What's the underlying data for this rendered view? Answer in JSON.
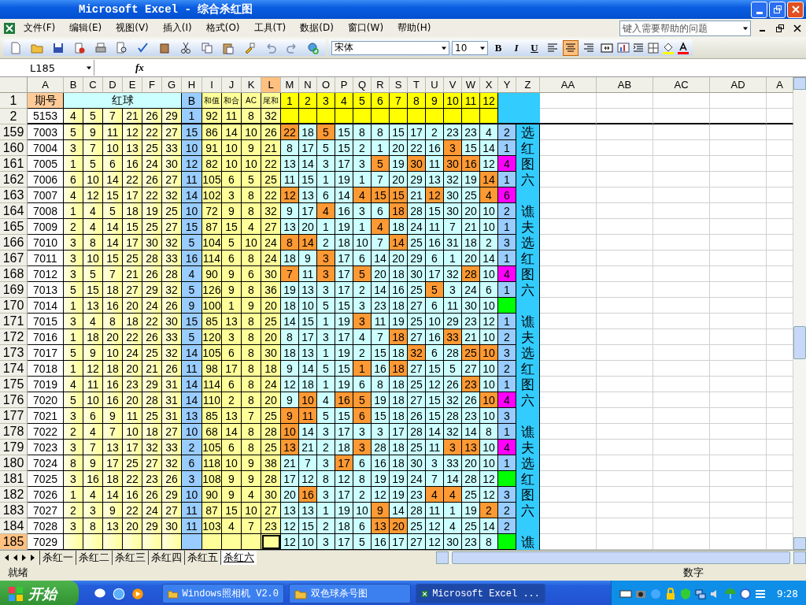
{
  "window": {
    "title": "Microsoft Excel - 综合杀红图"
  },
  "menu": [
    "文件(F)",
    "编辑(E)",
    "视图(V)",
    "插入(I)",
    "格式(O)",
    "工具(T)",
    "数据(D)",
    "窗口(W)",
    "帮助(H)"
  ],
  "help_box": {
    "placeholder": "键入需要帮助的问题"
  },
  "font_box": {
    "value": "宋体"
  },
  "size_box": {
    "value": "10"
  },
  "format_buttons": [
    "B",
    "I",
    "U"
  ],
  "align_buttons": [
    {
      "kind": "left",
      "selected": false
    },
    {
      "kind": "center",
      "selected": true
    },
    {
      "kind": "right",
      "selected": false
    },
    {
      "kind": "merge",
      "selected": false
    }
  ],
  "name_box": {
    "value": "L185"
  },
  "fx_label": "fx",
  "columns": [
    {
      "label": "A",
      "selected": false
    },
    {
      "label": "B",
      "selected": false
    },
    {
      "label": "C",
      "selected": false
    },
    {
      "label": "D",
      "selected": false
    },
    {
      "label": "E",
      "selected": false
    },
    {
      "label": "F",
      "selected": false
    },
    {
      "label": "G",
      "selected": false
    },
    {
      "label": "H",
      "selected": false
    },
    {
      "label": "I",
      "selected": false
    },
    {
      "label": "J",
      "selected": false
    },
    {
      "label": "K",
      "selected": false
    },
    {
      "label": "L",
      "selected": true
    },
    {
      "label": "M",
      "selected": false
    },
    {
      "label": "N",
      "selected": false
    },
    {
      "label": "O",
      "selected": false
    },
    {
      "label": "P",
      "selected": false
    },
    {
      "label": "Q",
      "selected": false
    },
    {
      "label": "R",
      "selected": false
    },
    {
      "label": "S",
      "selected": false
    },
    {
      "label": "T",
      "selected": false
    },
    {
      "label": "U",
      "selected": false
    },
    {
      "label": "V",
      "selected": false
    },
    {
      "label": "W",
      "selected": false
    },
    {
      "label": "X",
      "selected": false
    },
    {
      "label": "Y",
      "selected": false
    },
    {
      "label": "Z",
      "selected": false
    },
    {
      "label": "AA",
      "selected": false
    },
    {
      "label": "AB",
      "selected": false
    },
    {
      "label": "AC",
      "selected": false
    },
    {
      "label": "AD",
      "selected": false
    },
    {
      "label": "A",
      "selected": false
    }
  ],
  "rows": [
    {
      "num": "1",
      "kind": "header",
      "selected": false,
      "period": "期号",
      "red_label": "红球",
      "blue": "B",
      "stats": [
        "和值",
        "和合",
        "AC",
        "尾和"
      ],
      "positions": [
        "1",
        "2",
        "3",
        "4",
        "5",
        "6",
        "7",
        "8",
        "9",
        "10",
        "11",
        "12"
      ]
    },
    {
      "num": "2",
      "kind": "base",
      "selected": false,
      "period": "5153",
      "reds": [
        "4",
        "5",
        "7",
        "21",
        "26",
        "29"
      ],
      "blue": "1",
      "stats": [
        "92",
        "11",
        "8",
        "32"
      ]
    },
    {
      "num": "159",
      "kind": "data",
      "selected": false,
      "period": "7003",
      "reds": [
        "5",
        "9",
        "11",
        "12",
        "22",
        "27"
      ],
      "blue": "15",
      "stats": [
        "86",
        "14",
        "10",
        "26"
      ],
      "cells": [
        {
          "v": "22",
          "hit": true
        },
        {
          "v": "18",
          "hit": false
        },
        {
          "v": "5",
          "hit": true
        },
        {
          "v": "15",
          "hit": false
        },
        {
          "v": "8",
          "hit": false
        },
        {
          "v": "8",
          "hit": false
        },
        {
          "v": "15",
          "hit": false
        },
        {
          "v": "17",
          "hit": false
        },
        {
          "v": "2",
          "hit": false
        },
        {
          "v": "23",
          "hit": false
        },
        {
          "v": "23",
          "hit": false
        },
        {
          "v": "4",
          "hit": false
        }
      ],
      "count": "2",
      "color": "#99ccff",
      "side": "选"
    },
    {
      "num": "160",
      "kind": "data",
      "selected": false,
      "period": "7004",
      "reds": [
        "3",
        "7",
        "10",
        "13",
        "25",
        "33"
      ],
      "blue": "10",
      "stats": [
        "91",
        "10",
        "9",
        "21"
      ],
      "cells": [
        {
          "v": "8",
          "hit": false
        },
        {
          "v": "17",
          "hit": false
        },
        {
          "v": "5",
          "hit": false
        },
        {
          "v": "15",
          "hit": false
        },
        {
          "v": "2",
          "hit": false
        },
        {
          "v": "1",
          "hit": false
        },
        {
          "v": "20",
          "hit": false
        },
        {
          "v": "22",
          "hit": false
        },
        {
          "v": "16",
          "hit": false
        },
        {
          "v": "3",
          "hit": true
        },
        {
          "v": "15",
          "hit": false
        },
        {
          "v": "14",
          "hit": false
        }
      ],
      "count": "1",
      "color": "#99ccff",
      "side": "红"
    },
    {
      "num": "161",
      "kind": "data",
      "selected": false,
      "period": "7005",
      "reds": [
        "1",
        "5",
        "6",
        "16",
        "24",
        "30"
      ],
      "blue": "12",
      "stats": [
        "82",
        "10",
        "10",
        "22"
      ],
      "cells": [
        {
          "v": "13",
          "hit": false
        },
        {
          "v": "14",
          "hit": false
        },
        {
          "v": "3",
          "hit": false
        },
        {
          "v": "17",
          "hit": false
        },
        {
          "v": "3",
          "hit": false
        },
        {
          "v": "5",
          "hit": true
        },
        {
          "v": "19",
          "hit": false
        },
        {
          "v": "30",
          "hit": true
        },
        {
          "v": "11",
          "hit": false
        },
        {
          "v": "30",
          "hit": true
        },
        {
          "v": "16",
          "hit": true
        },
        {
          "v": "12",
          "hit": false
        }
      ],
      "count": "4",
      "color": "#ff00ff",
      "side": "图"
    },
    {
      "num": "162",
      "kind": "data",
      "selected": false,
      "period": "7006",
      "reds": [
        "6",
        "10",
        "14",
        "22",
        "26",
        "27"
      ],
      "blue": "11",
      "stats": [
        "105",
        "6",
        "5",
        "25"
      ],
      "cells": [
        {
          "v": "11",
          "hit": false
        },
        {
          "v": "15",
          "hit": false
        },
        {
          "v": "1",
          "hit": false
        },
        {
          "v": "19",
          "hit": false
        },
        {
          "v": "1",
          "hit": false
        },
        {
          "v": "7",
          "hit": false
        },
        {
          "v": "20",
          "hit": false
        },
        {
          "v": "29",
          "hit": false
        },
        {
          "v": "13",
          "hit": false
        },
        {
          "v": "32",
          "hit": false
        },
        {
          "v": "19",
          "hit": false
        },
        {
          "v": "14",
          "hit": true
        }
      ],
      "count": "1",
      "color": "#99ccff",
      "side": "六"
    },
    {
      "num": "163",
      "kind": "data",
      "selected": false,
      "period": "7007",
      "reds": [
        "4",
        "12",
        "15",
        "17",
        "22",
        "32"
      ],
      "blue": "14",
      "stats": [
        "102",
        "3",
        "8",
        "22"
      ],
      "cells": [
        {
          "v": "12",
          "hit": true
        },
        {
          "v": "13",
          "hit": false
        },
        {
          "v": "6",
          "hit": false
        },
        {
          "v": "14",
          "hit": false
        },
        {
          "v": "4",
          "hit": true
        },
        {
          "v": "15",
          "hit": true
        },
        {
          "v": "15",
          "hit": true
        },
        {
          "v": "21",
          "hit": false
        },
        {
          "v": "12",
          "hit": true
        },
        {
          "v": "30",
          "hit": false
        },
        {
          "v": "25",
          "hit": false
        },
        {
          "v": "4",
          "hit": true
        }
      ],
      "count": "6",
      "color": "#ff00ff"
    },
    {
      "num": "164",
      "kind": "data",
      "selected": false,
      "period": "7008",
      "reds": [
        "1",
        "4",
        "5",
        "18",
        "19",
        "25"
      ],
      "blue": "10",
      "stats": [
        "72",
        "9",
        "8",
        "32"
      ],
      "cells": [
        {
          "v": "9",
          "hit": false
        },
        {
          "v": "17",
          "hit": false
        },
        {
          "v": "4",
          "hit": true
        },
        {
          "v": "16",
          "hit": false
        },
        {
          "v": "3",
          "hit": false
        },
        {
          "v": "6",
          "hit": false
        },
        {
          "v": "18",
          "hit": true
        },
        {
          "v": "28",
          "hit": false
        },
        {
          "v": "15",
          "hit": false
        },
        {
          "v": "30",
          "hit": false
        },
        {
          "v": "20",
          "hit": false
        },
        {
          "v": "10",
          "hit": false
        }
      ],
      "count": "2",
      "color": "#99ccff",
      "side": "谯"
    },
    {
      "num": "165",
      "kind": "data",
      "selected": false,
      "period": "7009",
      "reds": [
        "2",
        "4",
        "14",
        "15",
        "25",
        "27"
      ],
      "blue": "15",
      "stats": [
        "87",
        "15",
        "4",
        "27"
      ],
      "cells": [
        {
          "v": "13",
          "hit": false
        },
        {
          "v": "20",
          "hit": false
        },
        {
          "v": "1",
          "hit": false
        },
        {
          "v": "19",
          "hit": false
        },
        {
          "v": "1",
          "hit": false
        },
        {
          "v": "4",
          "hit": true
        },
        {
          "v": "18",
          "hit": false
        },
        {
          "v": "24",
          "hit": false
        },
        {
          "v": "11",
          "hit": false
        },
        {
          "v": "7",
          "hit": false
        },
        {
          "v": "21",
          "hit": false
        },
        {
          "v": "10",
          "hit": false
        }
      ],
      "count": "1",
      "color": "#99ccff",
      "side": "夫"
    },
    {
      "num": "166",
      "kind": "data",
      "selected": false,
      "period": "7010",
      "reds": [
        "3",
        "8",
        "14",
        "17",
        "30",
        "32"
      ],
      "blue": "5",
      "stats": [
        "104",
        "5",
        "10",
        "24"
      ],
      "cells": [
        {
          "v": "8",
          "hit": true
        },
        {
          "v": "14",
          "hit": true
        },
        {
          "v": "2",
          "hit": false
        },
        {
          "v": "18",
          "hit": false
        },
        {
          "v": "10",
          "hit": false
        },
        {
          "v": "7",
          "hit": false
        },
        {
          "v": "14",
          "hit": true
        },
        {
          "v": "25",
          "hit": false
        },
        {
          "v": "16",
          "hit": false
        },
        {
          "v": "31",
          "hit": false
        },
        {
          "v": "18",
          "hit": false
        },
        {
          "v": "2",
          "hit": false
        }
      ],
      "count": "3",
      "color": "#99ccff",
      "side": "选"
    },
    {
      "num": "167",
      "kind": "data",
      "selected": false,
      "period": "7011",
      "reds": [
        "3",
        "10",
        "15",
        "25",
        "28",
        "33"
      ],
      "blue": "16",
      "stats": [
        "114",
        "6",
        "8",
        "24"
      ],
      "cells": [
        {
          "v": "18",
          "hit": false
        },
        {
          "v": "9",
          "hit": false
        },
        {
          "v": "3",
          "hit": true
        },
        {
          "v": "17",
          "hit": false
        },
        {
          "v": "6",
          "hit": false
        },
        {
          "v": "14",
          "hit": false
        },
        {
          "v": "20",
          "hit": false
        },
        {
          "v": "29",
          "hit": false
        },
        {
          "v": "6",
          "hit": false
        },
        {
          "v": "1",
          "hit": false
        },
        {
          "v": "20",
          "hit": false
        },
        {
          "v": "14",
          "hit": false
        }
      ],
      "count": "1",
      "color": "#99ccff",
      "side": "红"
    },
    {
      "num": "168",
      "kind": "data",
      "selected": false,
      "period": "7012",
      "reds": [
        "3",
        "5",
        "7",
        "21",
        "26",
        "28"
      ],
      "blue": "4",
      "stats": [
        "90",
        "9",
        "6",
        "30"
      ],
      "cells": [
        {
          "v": "7",
          "hit": true
        },
        {
          "v": "11",
          "hit": false
        },
        {
          "v": "3",
          "hit": true
        },
        {
          "v": "17",
          "hit": false
        },
        {
          "v": "5",
          "hit": true
        },
        {
          "v": "20",
          "hit": false
        },
        {
          "v": "18",
          "hit": false
        },
        {
          "v": "30",
          "hit": false
        },
        {
          "v": "17",
          "hit": false
        },
        {
          "v": "32",
          "hit": false
        },
        {
          "v": "28",
          "hit": true
        },
        {
          "v": "10",
          "hit": false
        }
      ],
      "count": "4",
      "color": "#ff00ff",
      "side": "图"
    },
    {
      "num": "169",
      "kind": "data",
      "selected": false,
      "period": "7013",
      "reds": [
        "5",
        "15",
        "18",
        "27",
        "29",
        "32"
      ],
      "blue": "5",
      "stats": [
        "126",
        "9",
        "8",
        "36"
      ],
      "cells": [
        {
          "v": "19",
          "hit": false
        },
        {
          "v": "13",
          "hit": false
        },
        {
          "v": "3",
          "hit": false
        },
        {
          "v": "17",
          "hit": false
        },
        {
          "v": "2",
          "hit": false
        },
        {
          "v": "14",
          "hit": false
        },
        {
          "v": "16",
          "hit": false
        },
        {
          "v": "25",
          "hit": false
        },
        {
          "v": "5",
          "hit": true
        },
        {
          "v": "3",
          "hit": false
        },
        {
          "v": "24",
          "hit": false
        },
        {
          "v": "6",
          "hit": false
        }
      ],
      "count": "1",
      "color": "#99ccff",
      "side": "六"
    },
    {
      "num": "170",
      "kind": "data",
      "selected": false,
      "period": "7014",
      "reds": [
        "1",
        "13",
        "16",
        "20",
        "24",
        "26"
      ],
      "blue": "9",
      "stats": [
        "100",
        "1",
        "9",
        "20"
      ],
      "cells": [
        {
          "v": "18",
          "hit": false
        },
        {
          "v": "10",
          "hit": false
        },
        {
          "v": "5",
          "hit": false
        },
        {
          "v": "15",
          "hit": false
        },
        {
          "v": "3",
          "hit": false
        },
        {
          "v": "23",
          "hit": false
        },
        {
          "v": "18",
          "hit": false
        },
        {
          "v": "27",
          "hit": false
        },
        {
          "v": "6",
          "hit": false
        },
        {
          "v": "11",
          "hit": false
        },
        {
          "v": "30",
          "hit": false
        },
        {
          "v": "10",
          "hit": false
        }
      ],
      "color": "#00ff00"
    },
    {
      "num": "171",
      "kind": "data",
      "selected": false,
      "period": "7015",
      "reds": [
        "3",
        "4",
        "8",
        "18",
        "22",
        "30"
      ],
      "blue": "15",
      "stats": [
        "85",
        "13",
        "8",
        "25"
      ],
      "cells": [
        {
          "v": "14",
          "hit": false
        },
        {
          "v": "15",
          "hit": false
        },
        {
          "v": "1",
          "hit": false
        },
        {
          "v": "19",
          "hit": false
        },
        {
          "v": "3",
          "hit": true
        },
        {
          "v": "11",
          "hit": false
        },
        {
          "v": "19",
          "hit": false
        },
        {
          "v": "25",
          "hit": false
        },
        {
          "v": "10",
          "hit": false
        },
        {
          "v": "29",
          "hit": false
        },
        {
          "v": "23",
          "hit": false
        },
        {
          "v": "12",
          "hit": false
        }
      ],
      "count": "1",
      "color": "#99ccff",
      "side": "谯"
    },
    {
      "num": "172",
      "kind": "data",
      "selected": false,
      "period": "7016",
      "reds": [
        "1",
        "18",
        "20",
        "22",
        "26",
        "33"
      ],
      "blue": "5",
      "stats": [
        "120",
        "3",
        "8",
        "20"
      ],
      "cells": [
        {
          "v": "8",
          "hit": false
        },
        {
          "v": "17",
          "hit": false
        },
        {
          "v": "3",
          "hit": false
        },
        {
          "v": "17",
          "hit": false
        },
        {
          "v": "4",
          "hit": false
        },
        {
          "v": "7",
          "hit": false
        },
        {
          "v": "18",
          "hit": true
        },
        {
          "v": "27",
          "hit": false
        },
        {
          "v": "16",
          "hit": false
        },
        {
          "v": "33",
          "hit": true
        },
        {
          "v": "21",
          "hit": false
        },
        {
          "v": "10",
          "hit": false
        }
      ],
      "count": "2",
      "color": "#99ccff",
      "side": "夫"
    },
    {
      "num": "173",
      "kind": "data",
      "selected": false,
      "period": "7017",
      "reds": [
        "5",
        "9",
        "10",
        "24",
        "25",
        "32"
      ],
      "blue": "14",
      "stats": [
        "105",
        "6",
        "8",
        "30"
      ],
      "cells": [
        {
          "v": "18",
          "hit": false
        },
        {
          "v": "13",
          "hit": false
        },
        {
          "v": "1",
          "hit": false
        },
        {
          "v": "19",
          "hit": false
        },
        {
          "v": "2",
          "hit": false
        },
        {
          "v": "15",
          "hit": false
        },
        {
          "v": "18",
          "hit": false
        },
        {
          "v": "32",
          "hit": true
        },
        {
          "v": "6",
          "hit": false
        },
        {
          "v": "28",
          "hit": false
        },
        {
          "v": "25",
          "hit": true
        },
        {
          "v": "10",
          "hit": true
        }
      ],
      "count": "3",
      "color": "#99ccff",
      "side": "选"
    },
    {
      "num": "174",
      "kind": "data",
      "selected": false,
      "period": "7018",
      "reds": [
        "1",
        "12",
        "18",
        "20",
        "21",
        "26"
      ],
      "blue": "11",
      "stats": [
        "98",
        "17",
        "8",
        "18"
      ],
      "cells": [
        {
          "v": "9",
          "hit": false
        },
        {
          "v": "14",
          "hit": false
        },
        {
          "v": "5",
          "hit": false
        },
        {
          "v": "15",
          "hit": false
        },
        {
          "v": "1",
          "hit": true
        },
        {
          "v": "16",
          "hit": false
        },
        {
          "v": "18",
          "hit": true
        },
        {
          "v": "27",
          "hit": false
        },
        {
          "v": "15",
          "hit": false
        },
        {
          "v": "5",
          "hit": false
        },
        {
          "v": "27",
          "hit": false
        },
        {
          "v": "10",
          "hit": false
        }
      ],
      "count": "2",
      "color": "#99ccff",
      "side": "红"
    },
    {
      "num": "175",
      "kind": "data",
      "selected": false,
      "period": "7019",
      "reds": [
        "4",
        "11",
        "16",
        "23",
        "29",
        "31"
      ],
      "blue": "14",
      "stats": [
        "114",
        "6",
        "8",
        "24"
      ],
      "cells": [
        {
          "v": "12",
          "hit": false
        },
        {
          "v": "18",
          "hit": false
        },
        {
          "v": "1",
          "hit": false
        },
        {
          "v": "19",
          "hit": false
        },
        {
          "v": "6",
          "hit": false
        },
        {
          "v": "8",
          "hit": false
        },
        {
          "v": "18",
          "hit": false
        },
        {
          "v": "25",
          "hit": false
        },
        {
          "v": "12",
          "hit": false
        },
        {
          "v": "26",
          "hit": false
        },
        {
          "v": "23",
          "hit": true
        },
        {
          "v": "10",
          "hit": false
        }
      ],
      "count": "1",
      "color": "#99ccff",
      "side": "图"
    },
    {
      "num": "176",
      "kind": "data",
      "selected": false,
      "period": "7020",
      "reds": [
        "5",
        "10",
        "16",
        "20",
        "28",
        "31"
      ],
      "blue": "14",
      "stats": [
        "110",
        "2",
        "8",
        "20"
      ],
      "cells": [
        {
          "v": "9",
          "hit": false
        },
        {
          "v": "10",
          "hit": true
        },
        {
          "v": "4",
          "hit": false
        },
        {
          "v": "16",
          "hit": true
        },
        {
          "v": "5",
          "hit": true
        },
        {
          "v": "19",
          "hit": false
        },
        {
          "v": "18",
          "hit": false
        },
        {
          "v": "27",
          "hit": false
        },
        {
          "v": "15",
          "hit": false
        },
        {
          "v": "32",
          "hit": false
        },
        {
          "v": "26",
          "hit": false
        },
        {
          "v": "10",
          "hit": true
        }
      ],
      "count": "4",
      "color": "#ff00ff",
      "side": "六"
    },
    {
      "num": "177",
      "kind": "data",
      "selected": false,
      "period": "7021",
      "reds": [
        "3",
        "6",
        "9",
        "11",
        "25",
        "31"
      ],
      "blue": "13",
      "stats": [
        "85",
        "13",
        "7",
        "25"
      ],
      "cells": [
        {
          "v": "9",
          "hit": true
        },
        {
          "v": "11",
          "hit": true
        },
        {
          "v": "5",
          "hit": false
        },
        {
          "v": "15",
          "hit": false
        },
        {
          "v": "6",
          "hit": true
        },
        {
          "v": "15",
          "hit": false
        },
        {
          "v": "18",
          "hit": false
        },
        {
          "v": "26",
          "hit": false
        },
        {
          "v": "15",
          "hit": false
        },
        {
          "v": "28",
          "hit": false
        },
        {
          "v": "23",
          "hit": false
        },
        {
          "v": "10",
          "hit": false
        }
      ],
      "count": "3",
      "color": "#99ccff"
    },
    {
      "num": "178",
      "kind": "data",
      "selected": false,
      "period": "7022",
      "reds": [
        "2",
        "4",
        "7",
        "10",
        "18",
        "27"
      ],
      "blue": "10",
      "stats": [
        "68",
        "14",
        "8",
        "28"
      ],
      "cells": [
        {
          "v": "10",
          "hit": true
        },
        {
          "v": "14",
          "hit": false
        },
        {
          "v": "3",
          "hit": false
        },
        {
          "v": "17",
          "hit": false
        },
        {
          "v": "3",
          "hit": false
        },
        {
          "v": "3",
          "hit": false
        },
        {
          "v": "17",
          "hit": false
        },
        {
          "v": "28",
          "hit": false
        },
        {
          "v": "14",
          "hit": false
        },
        {
          "v": "32",
          "hit": false
        },
        {
          "v": "14",
          "hit": false
        },
        {
          "v": "8",
          "hit": false
        }
      ],
      "count": "1",
      "color": "#99ccff",
      "side": "谯"
    },
    {
      "num": "179",
      "kind": "data",
      "selected": false,
      "period": "7023",
      "reds": [
        "3",
        "7",
        "13",
        "17",
        "32",
        "33"
      ],
      "blue": "2",
      "stats": [
        "105",
        "6",
        "8",
        "25"
      ],
      "cells": [
        {
          "v": "13",
          "hit": true
        },
        {
          "v": "21",
          "hit": false
        },
        {
          "v": "2",
          "hit": false
        },
        {
          "v": "18",
          "hit": false
        },
        {
          "v": "3",
          "hit": true
        },
        {
          "v": "28",
          "hit": false
        },
        {
          "v": "18",
          "hit": false
        },
        {
          "v": "25",
          "hit": false
        },
        {
          "v": "11",
          "hit": false
        },
        {
          "v": "3",
          "hit": true
        },
        {
          "v": "13",
          "hit": true
        },
        {
          "v": "10",
          "hit": false
        }
      ],
      "count": "4",
      "color": "#ff00ff",
      "side": "夫"
    },
    {
      "num": "180",
      "kind": "data",
      "selected": false,
      "period": "7024",
      "reds": [
        "8",
        "9",
        "17",
        "25",
        "27",
        "32"
      ],
      "blue": "6",
      "stats": [
        "118",
        "10",
        "9",
        "38"
      ],
      "cells": [
        {
          "v": "21",
          "hit": false
        },
        {
          "v": "7",
          "hit": false
        },
        {
          "v": "3",
          "hit": false
        },
        {
          "v": "17",
          "hit": true
        },
        {
          "v": "6",
          "hit": false
        },
        {
          "v": "16",
          "hit": false
        },
        {
          "v": "18",
          "hit": false
        },
        {
          "v": "30",
          "hit": false
        },
        {
          "v": "3",
          "hit": false
        },
        {
          "v": "33",
          "hit": false
        },
        {
          "v": "20",
          "hit": false
        },
        {
          "v": "10",
          "hit": false
        }
      ],
      "count": "1",
      "color": "#99ccff",
      "side": "选"
    },
    {
      "num": "181",
      "kind": "data",
      "selected": false,
      "period": "7025",
      "reds": [
        "3",
        "16",
        "18",
        "22",
        "23",
        "26"
      ],
      "blue": "3",
      "stats": [
        "108",
        "9",
        "9",
        "28"
      ],
      "cells": [
        {
          "v": "17",
          "hit": false
        },
        {
          "v": "12",
          "hit": false
        },
        {
          "v": "8",
          "hit": false
        },
        {
          "v": "12",
          "hit": false
        },
        {
          "v": "8",
          "hit": false
        },
        {
          "v": "19",
          "hit": false
        },
        {
          "v": "19",
          "hit": false
        },
        {
          "v": "24",
          "hit": false
        },
        {
          "v": "7",
          "hit": false
        },
        {
          "v": "14",
          "hit": false
        },
        {
          "v": "28",
          "hit": false
        },
        {
          "v": "12",
          "hit": false
        }
      ],
      "color": "#00ff00",
      "side": "红"
    },
    {
      "num": "182",
      "kind": "data",
      "selected": false,
      "period": "7026",
      "reds": [
        "1",
        "4",
        "14",
        "16",
        "26",
        "29"
      ],
      "blue": "10",
      "stats": [
        "90",
        "9",
        "4",
        "30"
      ],
      "cells": [
        {
          "v": "20",
          "hit": false
        },
        {
          "v": "16",
          "hit": true
        },
        {
          "v": "3",
          "hit": false
        },
        {
          "v": "17",
          "hit": false
        },
        {
          "v": "2",
          "hit": false
        },
        {
          "v": "12",
          "hit": false
        },
        {
          "v": "19",
          "hit": false
        },
        {
          "v": "23",
          "hit": false
        },
        {
          "v": "4",
          "hit": true
        },
        {
          "v": "4",
          "hit": true
        },
        {
          "v": "25",
          "hit": false
        },
        {
          "v": "12",
          "hit": false
        }
      ],
      "count": "3",
      "color": "#99ccff",
      "side": "图"
    },
    {
      "num": "183",
      "kind": "data",
      "selected": false,
      "period": "7027",
      "reds": [
        "2",
        "3",
        "9",
        "22",
        "24",
        "27"
      ],
      "blue": "11",
      "stats": [
        "87",
        "15",
        "10",
        "27"
      ],
      "cells": [
        {
          "v": "13",
          "hit": false
        },
        {
          "v": "13",
          "hit": false
        },
        {
          "v": "1",
          "hit": false
        },
        {
          "v": "19",
          "hit": false
        },
        {
          "v": "10",
          "hit": false
        },
        {
          "v": "9",
          "hit": true
        },
        {
          "v": "14",
          "hit": false
        },
        {
          "v": "28",
          "hit": false
        },
        {
          "v": "11",
          "hit": false
        },
        {
          "v": "1",
          "hit": false
        },
        {
          "v": "19",
          "hit": false
        },
        {
          "v": "2",
          "hit": true
        }
      ],
      "count": "2",
      "color": "#99ccff",
      "side": "六"
    },
    {
      "num": "184",
      "kind": "data",
      "selected": false,
      "period": "7028",
      "reds": [
        "3",
        "8",
        "13",
        "20",
        "29",
        "30"
      ],
      "blue": "11",
      "stats": [
        "103",
        "4",
        "7",
        "23"
      ],
      "cells": [
        {
          "v": "12",
          "hit": false
        },
        {
          "v": "15",
          "hit": false
        },
        {
          "v": "2",
          "hit": false
        },
        {
          "v": "18",
          "hit": false
        },
        {
          "v": "6",
          "hit": false
        },
        {
          "v": "13",
          "hit": true
        },
        {
          "v": "20",
          "hit": true
        },
        {
          "v": "25",
          "hit": false
        },
        {
          "v": "12",
          "hit": false
        },
        {
          "v": "4",
          "hit": false
        },
        {
          "v": "25",
          "hit": false
        },
        {
          "v": "14",
          "hit": false
        }
      ],
      "count": "2",
      "color": "#99ccff"
    },
    {
      "num": "185",
      "kind": "data",
      "selected": true,
      "period": "7029",
      "cells": [
        {
          "v": "12",
          "hit": false
        },
        {
          "v": "10",
          "hit": false
        },
        {
          "v": "3",
          "hit": false
        },
        {
          "v": "17",
          "hit": false
        },
        {
          "v": "5",
          "hit": false
        },
        {
          "v": "16",
          "hit": false
        },
        {
          "v": "17",
          "hit": false
        },
        {
          "v": "27",
          "hit": false
        },
        {
          "v": "12",
          "hit": false
        },
        {
          "v": "30",
          "hit": false
        },
        {
          "v": "23",
          "hit": false
        },
        {
          "v": "8",
          "hit": false
        }
      ],
      "color": "#00ff00",
      "side": "谯"
    }
  ],
  "sheet_tabs": [
    {
      "label": "杀红一",
      "selected": false
    },
    {
      "label": "杀红二",
      "selected": false
    },
    {
      "label": "杀红三",
      "selected": false
    },
    {
      "label": "杀红四",
      "selected": false
    },
    {
      "label": "杀红五",
      "selected": false
    },
    {
      "label": "杀红六",
      "selected": true
    }
  ],
  "status_bar": {
    "left": "就绪",
    "mode": "数字"
  },
  "taskbar": {
    "start": "开始",
    "tasks": [
      {
        "label": "Windows照相机 V2.0",
        "kind": "folder",
        "selected": false
      },
      {
        "label": "双色球杀号图",
        "kind": "folder",
        "selected": false
      },
      {
        "label": "Microsoft Excel ...",
        "kind": "excel",
        "selected": true
      }
    ],
    "time": "9:28"
  }
}
